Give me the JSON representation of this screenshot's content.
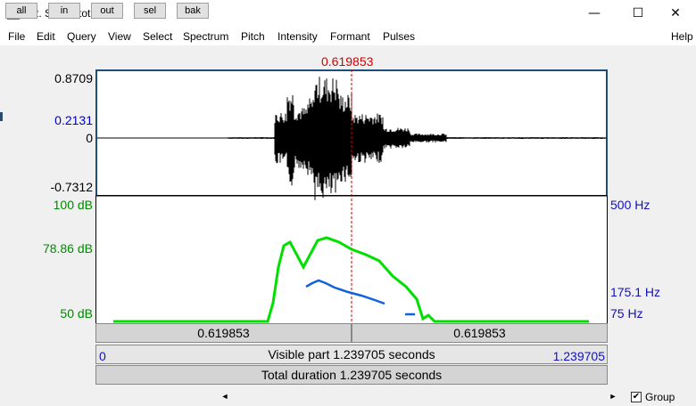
{
  "window": {
    "title": "72. Sound tote",
    "minimize": "—",
    "maximize": "☐",
    "close": "✕"
  },
  "menu": [
    "File",
    "Edit",
    "Query",
    "View",
    "Select",
    "Spectrum",
    "Pitch",
    "Intensity",
    "Formant",
    "Pulses"
  ],
  "menu_help": "Help",
  "cursor": {
    "time_label": "0.619853",
    "color": "#d40000"
  },
  "waveform": {
    "max_label": "0.8709",
    "cursor_value_label": "0.2131",
    "zero_label": "0",
    "min_label": "-0.7312"
  },
  "spectrogram": {
    "db_max": "100 dB",
    "db_cursor": "78.86 dB",
    "db_min": "50 dB",
    "hz_max": "500 Hz",
    "hz_cursor": "175.1 Hz",
    "hz_min": "75 Hz",
    "intensity_color": "#00e000",
    "pitch_color": "#1060e0"
  },
  "selection_bar": {
    "left": "0.619853",
    "right": "0.619853"
  },
  "visible_bar": {
    "start": "0",
    "label": "Visible part 1.239705 seconds",
    "end": "1.239705"
  },
  "total_bar": {
    "label": "Total duration 1.239705 seconds"
  },
  "buttons": {
    "all": "all",
    "in": "in",
    "out": "out",
    "sel": "sel",
    "bak": "bak"
  },
  "scroll": {
    "left_arrow": "◄",
    "right_arrow": "►"
  },
  "group": {
    "checked": "✔",
    "label": "Group"
  }
}
